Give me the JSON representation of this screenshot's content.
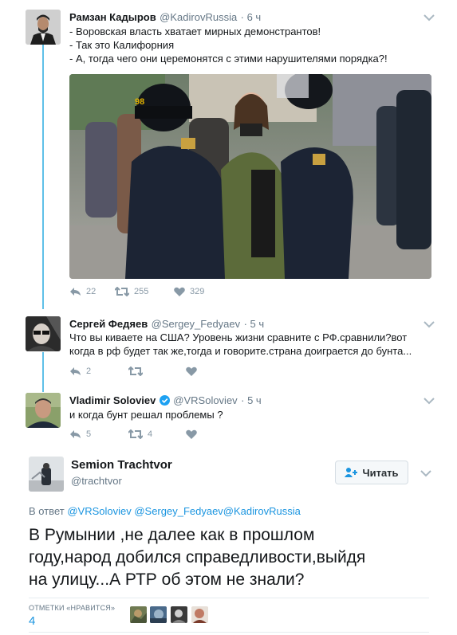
{
  "tweets": [
    {
      "name": "Рамзан Кадыров",
      "handle": "@KadirovRussia",
      "time": "· 6 ч",
      "lines": [
        "- Воровская власть хватает мирных демонстрантов!",
        "- Так это Калифорния",
        "- А, тогда чего они церемонятся с этими нарушителями порядка?!"
      ],
      "image_badge": "98",
      "replies": "22",
      "retweets": "255",
      "likes": "329"
    },
    {
      "name": "Сергей Федяев",
      "handle": "@Sergey_Fedyaev",
      "time": "· 5 ч",
      "lines": [
        "Что вы киваете на США? Уровень жизни сравните с РФ.сравнили?вот",
        "когда в рф будет так же,тогда и говорите.страна доиграется до бунта..."
      ],
      "replies": "2",
      "retweets": "",
      "likes": ""
    },
    {
      "name": "Vladimir Soloviev",
      "handle": "@VRSoloviev",
      "time": "· 5 ч",
      "lines": [
        "и когда бунт решал проблемы ?"
      ],
      "replies": "5",
      "retweets": "4",
      "likes": ""
    }
  ],
  "main": {
    "name": "Semion Trachtvor",
    "handle": "@trachtvor",
    "follow_label": "Читать",
    "reply_prefix": "В ответ",
    "reply_to": "@VRSoloviev @Sergey_Fedyaev@KadirovRussia",
    "text_lines": [
      "В Румынии ,не далее как в прошлом",
      "году,народ добился справедливости,выйдя",
      "на улицу...А РТР об этом не знали?"
    ],
    "likes_label": "ОТМЕТКИ «НРАВИТСЯ»",
    "likes_count": "4"
  },
  "colors": {
    "thread_line": "#5fc0e8",
    "link": "#1b95e0",
    "verified": "#1da1f2",
    "muted": "#657786"
  }
}
